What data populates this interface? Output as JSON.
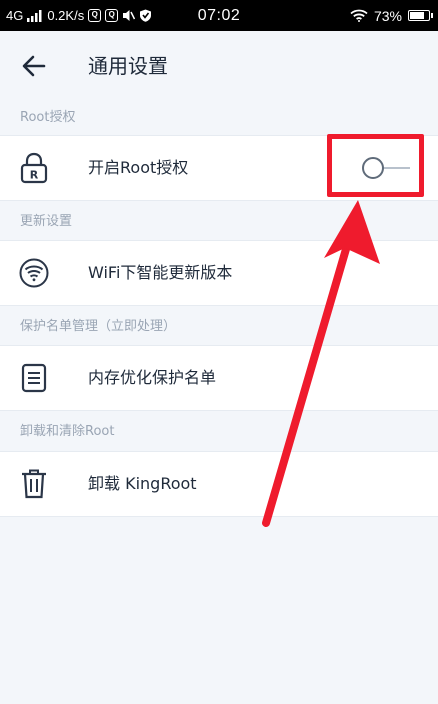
{
  "status_bar": {
    "network": "4G",
    "speed": "0.2K/s",
    "icon_a": "Q",
    "icon_b": "Q",
    "time": "07:02",
    "battery": "73%",
    "icons": [
      "signal-icon",
      "app-notification-icon",
      "app-notification-icon",
      "mute-icon",
      "shield-icon",
      "wifi-icon",
      "battery-icon"
    ]
  },
  "header": {
    "title": "通用设置",
    "back_icon": "arrow-left-icon"
  },
  "sections": [
    {
      "title": "Root授权",
      "item": {
        "label": "开启Root授权",
        "icon": "lock-r-icon",
        "toggle": false
      }
    },
    {
      "title": "更新设置",
      "item": {
        "label": "WiFi下智能更新版本",
        "icon": "wifi-circle-icon"
      }
    },
    {
      "title": "保护名单管理（立即处理）",
      "item": {
        "label": "内存优化保护名单",
        "icon": "document-icon"
      }
    },
    {
      "title": "卸载和清除Root",
      "item": {
        "label": "卸载 KingRoot",
        "icon": "trash-icon"
      }
    }
  ],
  "colors": {
    "background": "#f3f6fa",
    "row": "#ffffff",
    "section_text": "#9aa5b4",
    "annotation": "#ef1b2d"
  }
}
